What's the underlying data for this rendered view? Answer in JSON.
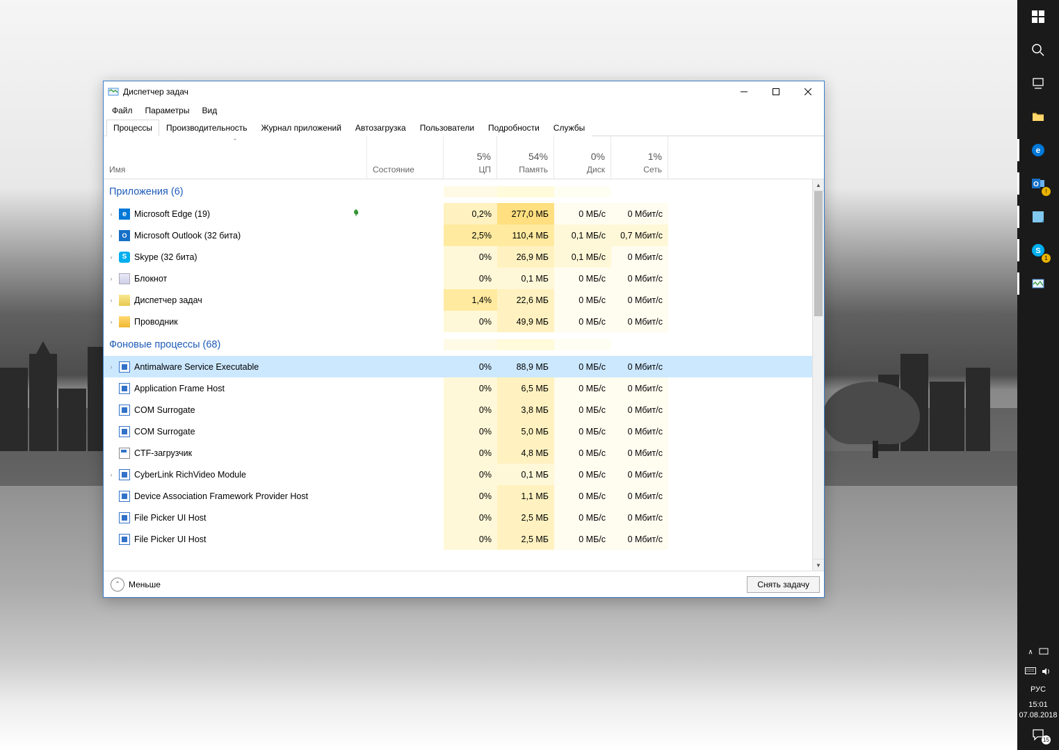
{
  "window": {
    "title": "Диспетчер задач",
    "menu": [
      "Файл",
      "Параметры",
      "Вид"
    ],
    "tabs": [
      "Процессы",
      "Производительность",
      "Журнал приложений",
      "Автозагрузка",
      "Пользователи",
      "Подробности",
      "Службы"
    ],
    "active_tab": 0,
    "columns": {
      "name": "Имя",
      "state": "Состояние",
      "cpu": {
        "value": "5%",
        "label": "ЦП"
      },
      "memory": {
        "value": "54%",
        "label": "Память"
      },
      "disk": {
        "value": "0%",
        "label": "Диск"
      },
      "network": {
        "value": "1%",
        "label": "Сеть"
      }
    },
    "groups": [
      {
        "title": "Приложения (6)",
        "rows": [
          {
            "exp": true,
            "name": "Microsoft Edge (19)",
            "icon": "edge",
            "leaf": true,
            "cpu": "0,2%",
            "cpu_h": 2,
            "mem": "277,0 МБ",
            "mem_h": 4,
            "disk": "0 МБ/с",
            "disk_h": 0,
            "net": "0 Мбит/с",
            "net_h": 0
          },
          {
            "exp": true,
            "name": "Microsoft Outlook (32 бита)",
            "icon": "outlook",
            "cpu": "2,5%",
            "cpu_h": 3,
            "mem": "110,4 МБ",
            "mem_h": 3,
            "disk": "0,1 МБ/с",
            "disk_h": 1,
            "net": "0,7 Мбит/с",
            "net_h": 1
          },
          {
            "exp": true,
            "name": "Skype (32 бита)",
            "icon": "skype",
            "cpu": "0%",
            "cpu_h": 1,
            "mem": "26,9 МБ",
            "mem_h": 2,
            "disk": "0,1 МБ/с",
            "disk_h": 1,
            "net": "0 Мбит/с",
            "net_h": 0
          },
          {
            "exp": true,
            "name": "Блокнот",
            "icon": "notepad",
            "cpu": "0%",
            "cpu_h": 1,
            "mem": "0,1 МБ",
            "mem_h": 1,
            "disk": "0 МБ/с",
            "disk_h": 0,
            "net": "0 Мбит/с",
            "net_h": 0
          },
          {
            "exp": true,
            "name": "Диспетчер задач",
            "icon": "taskmgr",
            "cpu": "1,4%",
            "cpu_h": 3,
            "mem": "22,6 МБ",
            "mem_h": 2,
            "disk": "0 МБ/с",
            "disk_h": 0,
            "net": "0 Мбит/с",
            "net_h": 0
          },
          {
            "exp": true,
            "name": "Проводник",
            "icon": "explorer",
            "cpu": "0%",
            "cpu_h": 1,
            "mem": "49,9 МБ",
            "mem_h": 2,
            "disk": "0 МБ/с",
            "disk_h": 0,
            "net": "0 Мбит/с",
            "net_h": 0
          }
        ]
      },
      {
        "title": "Фоновые процессы (68)",
        "rows": [
          {
            "exp": true,
            "sel": true,
            "name": "Antimalware Service Executable",
            "icon": "generic",
            "cpu": "0%",
            "cpu_h": 0,
            "mem": "88,9 МБ",
            "mem_h": 0,
            "disk": "0 МБ/с",
            "disk_h": 0,
            "net": "0 Мбит/с",
            "net_h": 0
          },
          {
            "name": "Application Frame Host",
            "icon": "generic",
            "cpu": "0%",
            "cpu_h": 1,
            "mem": "6,5 МБ",
            "mem_h": 2,
            "disk": "0 МБ/с",
            "disk_h": 0,
            "net": "0 Мбит/с",
            "net_h": 0
          },
          {
            "name": "COM Surrogate",
            "icon": "generic",
            "cpu": "0%",
            "cpu_h": 1,
            "mem": "3,8 МБ",
            "mem_h": 2,
            "disk": "0 МБ/с",
            "disk_h": 0,
            "net": "0 Мбит/с",
            "net_h": 0
          },
          {
            "name": "COM Surrogate",
            "icon": "generic",
            "cpu": "0%",
            "cpu_h": 1,
            "mem": "5,0 МБ",
            "mem_h": 2,
            "disk": "0 МБ/с",
            "disk_h": 0,
            "net": "0 Мбит/с",
            "net_h": 0
          },
          {
            "name": "CTF-загрузчик",
            "icon": "ctf",
            "cpu": "0%",
            "cpu_h": 1,
            "mem": "4,8 МБ",
            "mem_h": 2,
            "disk": "0 МБ/с",
            "disk_h": 0,
            "net": "0 Мбит/с",
            "net_h": 0
          },
          {
            "exp": true,
            "name": "CyberLink RichVideo Module",
            "icon": "generic",
            "cpu": "0%",
            "cpu_h": 1,
            "mem": "0,1 МБ",
            "mem_h": 1,
            "disk": "0 МБ/с",
            "disk_h": 0,
            "net": "0 Мбит/с",
            "net_h": 0
          },
          {
            "name": "Device Association Framework Provider Host",
            "icon": "generic",
            "cpu": "0%",
            "cpu_h": 1,
            "mem": "1,1 МБ",
            "mem_h": 2,
            "disk": "0 МБ/с",
            "disk_h": 0,
            "net": "0 Мбит/с",
            "net_h": 0
          },
          {
            "name": "File Picker UI Host",
            "icon": "generic",
            "cpu": "0%",
            "cpu_h": 1,
            "mem": "2,5 МБ",
            "mem_h": 2,
            "disk": "0 МБ/с",
            "disk_h": 0,
            "net": "0 Мбит/с",
            "net_h": 0
          },
          {
            "name": "File Picker UI Host",
            "icon": "generic",
            "cpu": "0%",
            "cpu_h": 1,
            "mem": "2,5 МБ",
            "mem_h": 2,
            "disk": "0 МБ/с",
            "disk_h": 0,
            "net": "0 Мбит/с",
            "net_h": 0
          }
        ]
      }
    ],
    "footer": {
      "fewer": "Меньше",
      "end_task": "Снять задачу"
    }
  },
  "taskbar": {
    "lang": "РУС",
    "time": "15:01",
    "date": "07.08.2018",
    "notif_count": "15",
    "skype_badge": "1"
  }
}
